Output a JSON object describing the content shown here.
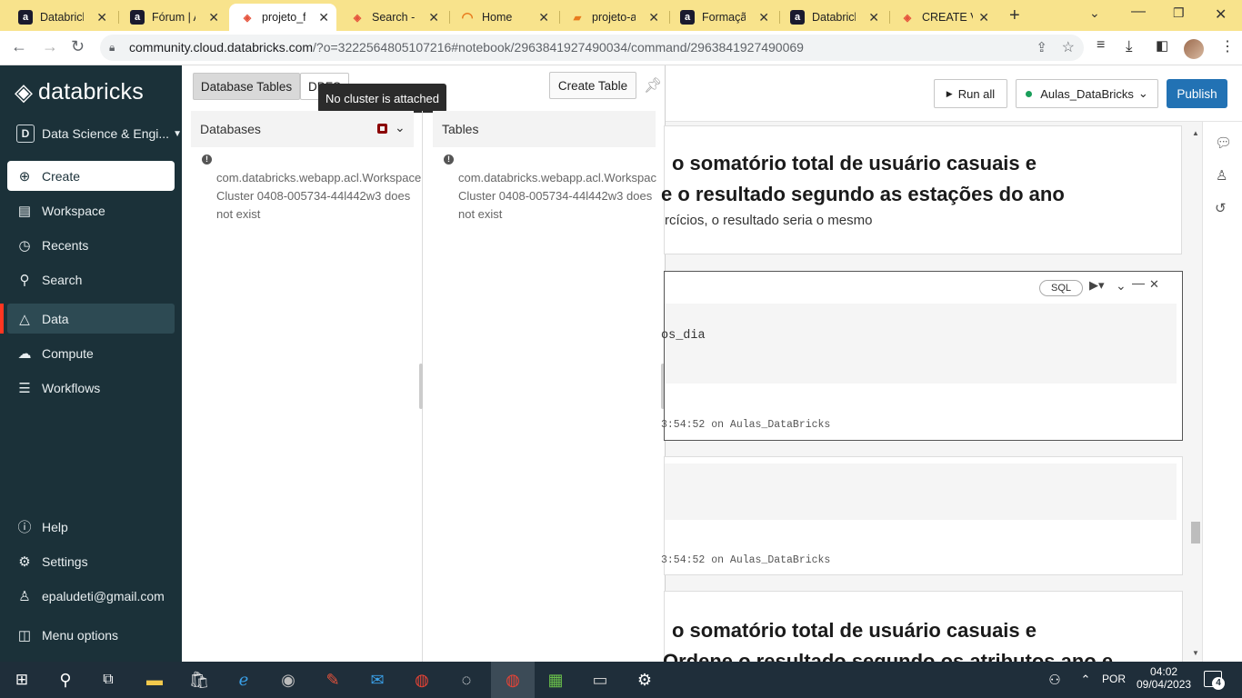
{
  "browser": {
    "tabs": [
      {
        "title": "Databricks",
        "favicon": "databricks-logo",
        "active": false
      },
      {
        "title": "Fórum | Alura",
        "favicon": "alura-logo",
        "active": false
      },
      {
        "title": "projeto_final",
        "favicon": "databricks-stack-icon",
        "active": true
      },
      {
        "title": "Search - Databricks",
        "favicon": "databricks-stack-icon",
        "active": false
      },
      {
        "title": "Home",
        "favicon": "home-loader-icon",
        "active": false
      },
      {
        "title": "projeto-aula",
        "favicon": "doc-icon",
        "active": false
      },
      {
        "title": "Formação",
        "favicon": "alura-logo",
        "active": false
      },
      {
        "title": "Databricks",
        "favicon": "alura-logo",
        "active": false
      },
      {
        "title": "CREATE VIEW",
        "favicon": "databricks-stack-icon",
        "active": false
      }
    ],
    "url_host": "community.cloud.databricks.com",
    "url_rest": "/?o=3222564805107216#notebook/2963841927490034/command/2963841927490069"
  },
  "sidebar": {
    "logo": "databricks",
    "persona": "Data Science & Engi...",
    "persona_icon": "D",
    "items": [
      {
        "label": "Create",
        "icon": "plus-circle-icon"
      },
      {
        "label": "Workspace",
        "icon": "workspace-icon"
      },
      {
        "label": "Recents",
        "icon": "clock-icon"
      },
      {
        "label": "Search",
        "icon": "search-icon"
      },
      {
        "label": "Data",
        "icon": "data-icon"
      },
      {
        "label": "Compute",
        "icon": "cloud-icon"
      },
      {
        "label": "Workflows",
        "icon": "workflows-icon"
      }
    ],
    "bottom": [
      {
        "label": "Help",
        "icon": "help-icon"
      },
      {
        "label": "Settings",
        "icon": "gear-icon"
      },
      {
        "label": "epaludeti@gmail.com",
        "icon": "user-icon"
      },
      {
        "label": "Menu options",
        "icon": "menu-icon"
      }
    ]
  },
  "data_panel": {
    "tab_database_tables": "Database Tables",
    "tab_dbfs": "DBFS",
    "tooltip": "No cluster is attached",
    "create_table": "Create Table",
    "databases_header": "Databases",
    "tables_header": "Tables",
    "error_lines": [
      "com.databricks.webapp.acl.Workspace",
      "Cluster 0408-005734-44l442w3 does",
      "not exist"
    ]
  },
  "notebook": {
    "run_all": "Run all",
    "cluster": "Aulas_DataBricks",
    "publish": "Publish",
    "cell1_line1": "o somatório total de usuário casuais e",
    "cell1_line2": "e o resultado segundo as estações do ano",
    "cell1_line3": "rcícios, o resultado seria o mesmo",
    "cell2_lang": "SQL",
    "cell2_code": "os_dia",
    "cell2_meta": "3:54:52 on Aulas_DataBricks",
    "cell3_meta": "3:54:52 on Aulas_DataBricks",
    "cell4_line1": "o somatório total de usuário casuais e",
    "cell4_line2": "Ordene o resultado segundo os atributos ano e"
  },
  "taskbar": {
    "lang": "POR",
    "time": "04:02",
    "date": "09/04/2023",
    "notifications": "4"
  },
  "colors": {
    "sidebar_bg": "#1b3139",
    "accent_red": "#ff3621",
    "publish_blue": "#2272b4",
    "tab_bar": "#f8e38c"
  }
}
